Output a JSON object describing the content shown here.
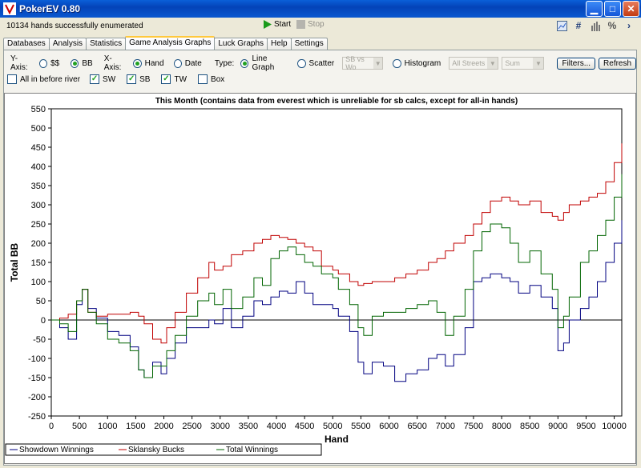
{
  "window": {
    "title": "PokerEV 0.80"
  },
  "toolbar": {
    "status": "10134 hands successfully enumerated",
    "start_label": "Start",
    "stop_label": "Stop"
  },
  "tabs": [
    {
      "label": "Databases"
    },
    {
      "label": "Analysis"
    },
    {
      "label": "Statistics"
    },
    {
      "label": "Game Analysis Graphs",
      "active": true
    },
    {
      "label": "Luck Graphs"
    },
    {
      "label": "Help"
    },
    {
      "label": "Settings"
    }
  ],
  "options": {
    "yaxis_label": "Y-Axis:",
    "y_dollars": "$$",
    "y_bb": "BB",
    "xaxis_label": "X-Axis:",
    "x_hand": "Hand",
    "x_date": "Date",
    "type_label": "Type:",
    "line_graph": "Line Graph",
    "scatter": "Scatter",
    "scatter_select": "SB vs Wo",
    "histogram": "Histogram",
    "streets_select": "All Streets",
    "sum_select": "Sum",
    "filters": "Filters...",
    "refresh": "Refresh",
    "all_in": "All in before river",
    "sw": "SW",
    "sb": "SB",
    "tw": "TW",
    "box": "Box"
  },
  "chart_data": {
    "type": "line",
    "title": "This Month (contains data from everest which is unreliable for sb calcs, except for all-in hands)",
    "xlabel": "Hand",
    "ylabel": "Total BB",
    "xlim": [
      0,
      10134
    ],
    "ylim": [
      -250,
      550
    ],
    "xticks": [
      0,
      500,
      1000,
      1500,
      2000,
      2500,
      3000,
      3500,
      4000,
      4500,
      5000,
      5500,
      6000,
      6500,
      7000,
      7500,
      8000,
      8500,
      9000,
      9500,
      10000
    ],
    "yticks": [
      -250,
      -200,
      -150,
      -100,
      -50,
      0,
      50,
      100,
      150,
      200,
      250,
      300,
      350,
      400,
      450,
      500,
      550
    ],
    "grid": false,
    "legend_position": "bottom",
    "series": [
      {
        "name": "Showdown Winnings",
        "color": "#000080",
        "x": [
          0,
          150,
          300,
          450,
          550,
          650,
          800,
          1000,
          1200,
          1400,
          1550,
          1650,
          1800,
          1950,
          2050,
          2200,
          2400,
          2600,
          2800,
          2900,
          3050,
          3200,
          3400,
          3600,
          3750,
          3900,
          4050,
          4200,
          4350,
          4500,
          4650,
          4800,
          5000,
          5100,
          5300,
          5450,
          5550,
          5700,
          5900,
          6100,
          6300,
          6500,
          6700,
          6850,
          7000,
          7150,
          7350,
          7500,
          7650,
          7800,
          8000,
          8150,
          8300,
          8500,
          8700,
          8900,
          9000,
          9100,
          9200,
          9400,
          9550,
          9700,
          9850,
          10000,
          10134
        ],
        "values": [
          0,
          -20,
          -50,
          40,
          80,
          30,
          5,
          -30,
          -40,
          -70,
          -130,
          -150,
          -110,
          -140,
          -100,
          -60,
          -20,
          -20,
          0,
          -10,
          30,
          -20,
          10,
          50,
          40,
          60,
          75,
          70,
          100,
          70,
          40,
          40,
          30,
          10,
          -30,
          -110,
          -140,
          -110,
          -120,
          -160,
          -140,
          -130,
          -100,
          -90,
          -120,
          -90,
          -20,
          100,
          110,
          120,
          110,
          100,
          70,
          90,
          60,
          30,
          -80,
          -60,
          0,
          30,
          60,
          100,
          150,
          200,
          260
        ]
      },
      {
        "name": "Sklansky Bucks",
        "color": "#c00000",
        "x": [
          0,
          150,
          300,
          450,
          550,
          650,
          800,
          1000,
          1200,
          1400,
          1550,
          1650,
          1800,
          1950,
          2050,
          2200,
          2400,
          2600,
          2800,
          2900,
          3050,
          3200,
          3400,
          3600,
          3750,
          3900,
          4050,
          4200,
          4350,
          4500,
          4650,
          4800,
          5000,
          5100,
          5300,
          5450,
          5550,
          5700,
          5900,
          6100,
          6300,
          6500,
          6700,
          6850,
          7000,
          7150,
          7350,
          7500,
          7650,
          7800,
          8000,
          8150,
          8300,
          8500,
          8700,
          8900,
          9000,
          9100,
          9200,
          9400,
          9550,
          9700,
          9850,
          10000,
          10134
        ],
        "values": [
          0,
          5,
          15,
          50,
          80,
          20,
          10,
          15,
          15,
          20,
          10,
          -10,
          -50,
          -60,
          -20,
          20,
          70,
          110,
          150,
          130,
          140,
          170,
          180,
          200,
          210,
          220,
          215,
          210,
          200,
          190,
          180,
          140,
          130,
          120,
          100,
          90,
          95,
          100,
          100,
          110,
          120,
          130,
          150,
          160,
          180,
          200,
          220,
          250,
          280,
          310,
          320,
          310,
          300,
          310,
          280,
          270,
          260,
          280,
          300,
          310,
          320,
          330,
          360,
          410,
          460
        ]
      },
      {
        "name": "Total Winnings",
        "color": "#006400",
        "x": [
          0,
          150,
          300,
          450,
          550,
          650,
          800,
          1000,
          1200,
          1400,
          1550,
          1650,
          1800,
          1950,
          2050,
          2200,
          2400,
          2600,
          2800,
          2900,
          3050,
          3200,
          3400,
          3600,
          3750,
          3900,
          4050,
          4200,
          4350,
          4500,
          4650,
          4800,
          5000,
          5100,
          5300,
          5450,
          5550,
          5700,
          5900,
          6100,
          6300,
          6500,
          6700,
          6850,
          7000,
          7150,
          7350,
          7500,
          7650,
          7800,
          8000,
          8150,
          8300,
          8500,
          8700,
          8900,
          9000,
          9100,
          9200,
          9400,
          9550,
          9700,
          9850,
          10000,
          10134
        ],
        "values": [
          0,
          -10,
          -30,
          50,
          80,
          20,
          -10,
          -50,
          -60,
          -80,
          -130,
          -150,
          -120,
          -120,
          -80,
          -40,
          10,
          50,
          70,
          40,
          80,
          30,
          60,
          110,
          90,
          160,
          180,
          190,
          170,
          150,
          140,
          120,
          110,
          80,
          40,
          -20,
          -40,
          10,
          20,
          20,
          30,
          40,
          50,
          20,
          -40,
          10,
          80,
          180,
          230,
          250,
          240,
          200,
          150,
          180,
          120,
          80,
          -20,
          10,
          60,
          150,
          180,
          220,
          260,
          320,
          380
        ]
      }
    ]
  }
}
